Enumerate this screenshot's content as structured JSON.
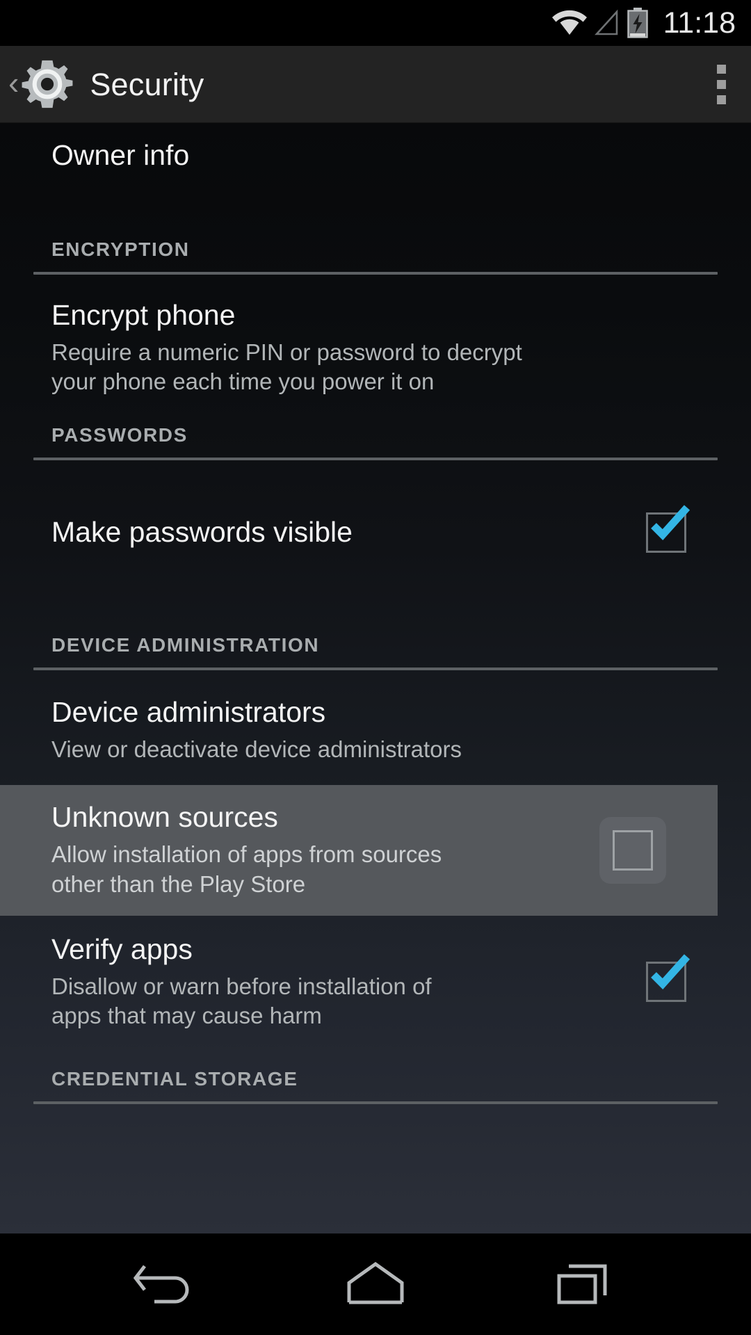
{
  "status_bar": {
    "time": "11:18",
    "icons": [
      {
        "name": "wifi-icon",
        "label": "wifi"
      },
      {
        "name": "cell-signal-icon",
        "label": "no-signal"
      },
      {
        "name": "battery-charging-icon",
        "label": "battery-charging"
      }
    ]
  },
  "action_bar": {
    "up_chevron": "‹",
    "app_icon": "settings-gear-icon",
    "title": "Security",
    "overflow_label": "More options"
  },
  "colors": {
    "accent_check": "#33b5e5",
    "action_bar_bg": "#232323",
    "highlight_row_bg": "#55585c",
    "section_header_text": "#a9adaf",
    "title_text": "#f4f4f4",
    "summary_text": "#b2b6b8",
    "divider": "#5d6164"
  },
  "screen": {
    "items": [
      {
        "type": "item",
        "name": "owner-info",
        "title": "Owner info",
        "summary": "",
        "widget": "none"
      },
      {
        "type": "section",
        "name": "section-encryption",
        "title": "ENCRYPTION"
      },
      {
        "type": "item",
        "name": "encrypt-phone",
        "title": "Encrypt phone",
        "summary": "Require a numeric PIN or password to decrypt your phone each time you power it on",
        "widget": "none"
      },
      {
        "type": "section",
        "name": "section-passwords",
        "title": "PASSWORDS"
      },
      {
        "type": "item",
        "name": "make-passwords-visible",
        "title": "Make passwords visible",
        "summary": "",
        "widget": "checkbox",
        "checked": true,
        "highlighted": false
      },
      {
        "type": "section",
        "name": "section-device-administration",
        "title": "DEVICE ADMINISTRATION"
      },
      {
        "type": "item",
        "name": "device-administrators",
        "title": "Device administrators",
        "summary": "View or deactivate device administrators",
        "widget": "none"
      },
      {
        "type": "item",
        "name": "unknown-sources",
        "title": "Unknown sources",
        "summary": "Allow installation of apps from sources other than the Play Store",
        "widget": "checkbox",
        "checked": false,
        "highlighted": true
      },
      {
        "type": "item",
        "name": "verify-apps",
        "title": "Verify apps",
        "summary": "Disallow or warn before installation of apps that may cause harm",
        "widget": "checkbox",
        "checked": true,
        "highlighted": false
      },
      {
        "type": "section",
        "name": "section-credential-storage",
        "title": "CREDENTIAL STORAGE"
      }
    ]
  },
  "nav_bar": {
    "buttons": [
      {
        "name": "nav-back-button",
        "label": "Back"
      },
      {
        "name": "nav-home-button",
        "label": "Home"
      },
      {
        "name": "nav-recents-button",
        "label": "Recent apps"
      }
    ]
  }
}
